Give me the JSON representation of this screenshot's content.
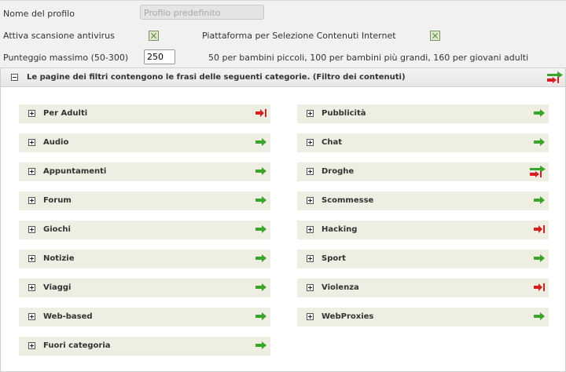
{
  "form": {
    "profile_name_label": "Nome del profilo",
    "profile_name_value": "Profilo predefinito",
    "antivirus_label": "Attiva scansione antivirus",
    "antivirus_checked": true,
    "pics_label": "Piattaforma per Selezione Contenuti Internet",
    "pics_checked": true,
    "max_score_label": "Punteggio massimo (50-300)",
    "max_score_value": "250",
    "max_score_hint": "50 per bambini piccoli, 100 per bambini più grandi, 160 per giovani adulti"
  },
  "section": {
    "title": "Le pagine dei filtri contengono le frasi delle seguenti categorie. (Filtro dei contenuti)",
    "action_icon": "mixed-allow-block-icon"
  },
  "categories": [
    {
      "label": "Per Adulti",
      "action": "block"
    },
    {
      "label": "Pubblicità",
      "action": "allow"
    },
    {
      "label": "Audio",
      "action": "allow"
    },
    {
      "label": "Chat",
      "action": "allow"
    },
    {
      "label": "Appuntamenti",
      "action": "allow"
    },
    {
      "label": "Droghe",
      "action": "mixed"
    },
    {
      "label": "Forum",
      "action": "allow"
    },
    {
      "label": "Scommesse",
      "action": "allow"
    },
    {
      "label": "Giochi",
      "action": "allow"
    },
    {
      "label": "Hacking",
      "action": "block"
    },
    {
      "label": "Notizie",
      "action": "allow"
    },
    {
      "label": "Sport",
      "action": "allow"
    },
    {
      "label": "Viaggi",
      "action": "allow"
    },
    {
      "label": "Violenza",
      "action": "block"
    },
    {
      "label": "Web-based",
      "action": "allow"
    },
    {
      "label": "WebProxies",
      "action": "allow"
    },
    {
      "label": "Fuori categoria",
      "action": "allow"
    }
  ],
  "colors": {
    "allow": "#3aa52a",
    "block": "#d42020"
  }
}
